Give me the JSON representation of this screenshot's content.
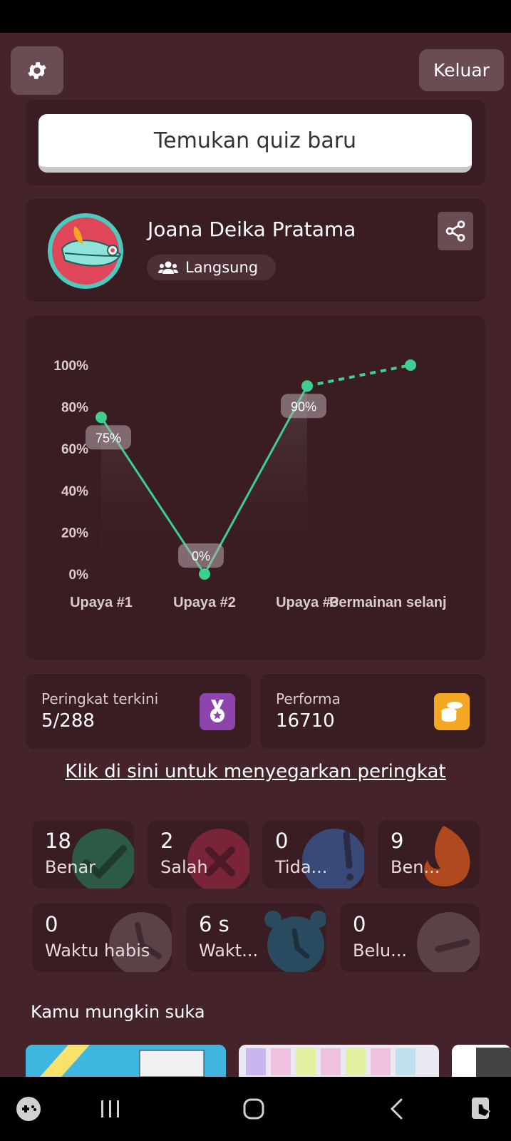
{
  "header": {
    "logout_label": "Keluar"
  },
  "search": {
    "button_label": "Temukan quiz baru"
  },
  "profile": {
    "name": "Joana Deika Pratama",
    "mode_label": "Langsung"
  },
  "chart_data": {
    "type": "line",
    "categories": [
      "Upaya #1",
      "Upaya #2",
      "Upaya #3",
      "Permainan selanj"
    ],
    "series": [
      {
        "values": [
          75,
          0,
          90,
          100
        ]
      }
    ],
    "data_labels": [
      "75%",
      "0%",
      "90%"
    ],
    "y_ticks": [
      "0%",
      "20%",
      "40%",
      "60%",
      "80%",
      "100%"
    ],
    "ylim": [
      0,
      100
    ],
    "projected_segment": "dashed line from Upaya #3 to Permainan selanj",
    "line_color": "#3ecf8e",
    "grid": false
  },
  "stats": {
    "rank_label": "Peringkat terkini",
    "rank_value": "5/288",
    "performance_label": "Performa",
    "performance_value": "16710",
    "rank_icon": "medal-icon",
    "performance_icon": "coins-icon",
    "rank_icon_color": "#8e44ad",
    "performance_icon_color": "#f5a623"
  },
  "refresh_link": "Klik di sini untuk menyegarkan peringkat",
  "tiles_row1": [
    {
      "value": "18",
      "label": "Benar",
      "icon": "check-icon",
      "color": "#2c5a44"
    },
    {
      "value": "2",
      "label": "Salah",
      "icon": "cross-icon",
      "color": "#7a2439"
    },
    {
      "value": "0",
      "label": "Tida...",
      "icon": "exclamation-icon",
      "color": "#3a4a78"
    },
    {
      "value": "9",
      "label": "Ben...",
      "icon": "flame-icon",
      "color": "#b04a1e"
    }
  ],
  "tiles_row2": [
    {
      "value": "0",
      "label": "Waktu habis",
      "icon": "clock-icon",
      "color": "#5a4247"
    },
    {
      "value": "6 s",
      "label": "Wakt...",
      "icon": "alarm-clock-icon",
      "color": "#2a4a5f"
    },
    {
      "value": "0",
      "label": "Belu...",
      "icon": "minus-icon",
      "color": "#5a4247"
    }
  ],
  "suggestions": {
    "title": "Kamu mungkin suka"
  }
}
